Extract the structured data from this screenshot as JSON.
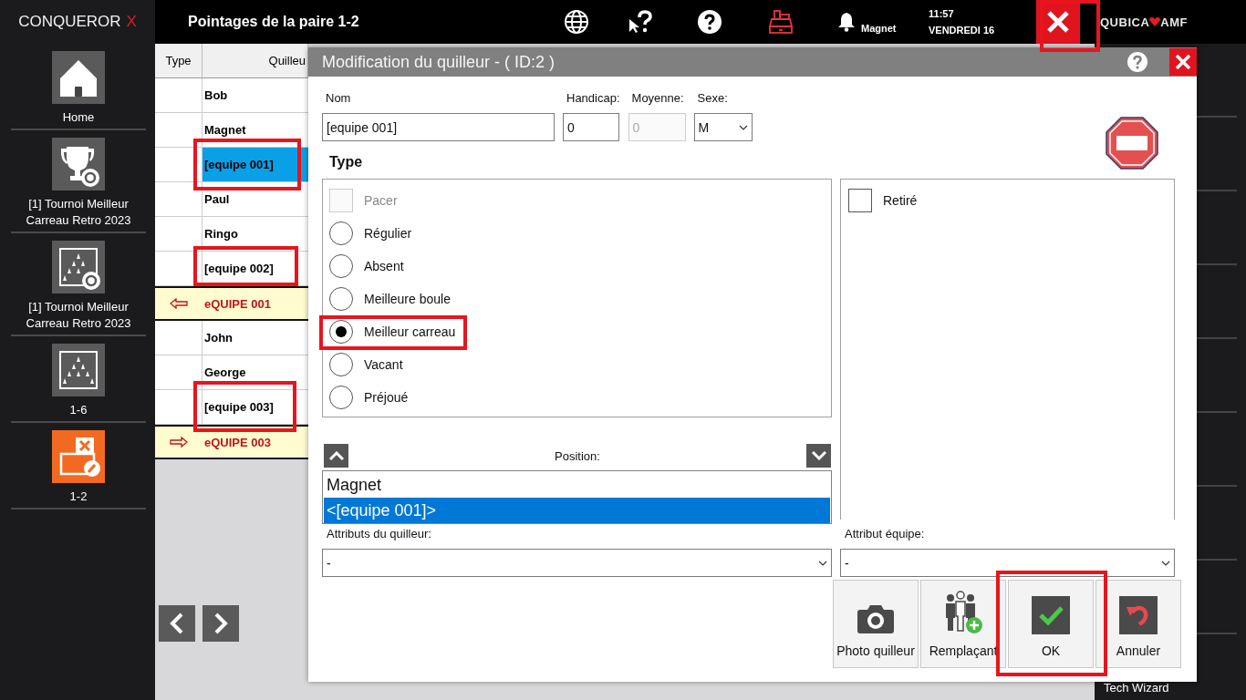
{
  "app": {
    "logo": "CONQUEROR",
    "logo_mark": "X"
  },
  "sidebar": {
    "items": [
      {
        "kind": "home",
        "label": "Home",
        "selected": false
      },
      {
        "kind": "trophy",
        "label": "[1] Tournoi Meilleur Carreau Retro 2023",
        "selected": false
      },
      {
        "kind": "lane-settings",
        "label": "[1] Tournoi Meilleur Carreau Retro 2023",
        "selected": false
      },
      {
        "kind": "lane",
        "label": "1-6",
        "selected": false
      },
      {
        "kind": "score",
        "label": "1-2",
        "selected": true
      }
    ]
  },
  "topbar": {
    "title": "Pointages de la paire 1-2",
    "user": "Magnet",
    "time": "11:57",
    "date": "VENDREDI 16",
    "brand": {
      "left": "QUBICA",
      "right": "AMF"
    }
  },
  "table": {
    "columns": [
      "Type",
      "Quilleu"
    ],
    "rows": [
      {
        "kind": "bowler",
        "name": "Bob",
        "selected": false
      },
      {
        "kind": "bowler",
        "name": "Magnet",
        "selected": false
      },
      {
        "kind": "bowler",
        "name": "[equipe 001]",
        "selected": true
      },
      {
        "kind": "bowler",
        "name": "Paul",
        "selected": false
      },
      {
        "kind": "bowler",
        "name": "Ringo",
        "selected": false
      },
      {
        "kind": "bowler",
        "name": "[equipe 002]",
        "selected": false
      },
      {
        "kind": "team-left",
        "name": "eQUIPE 001",
        "selected": false
      },
      {
        "kind": "bowler",
        "name": "John",
        "selected": false
      },
      {
        "kind": "bowler",
        "name": "George",
        "selected": false
      },
      {
        "kind": "bowler",
        "name": "[equipe 003]",
        "selected": false
      },
      {
        "kind": "team-right",
        "name": "eQUIPE 003",
        "selected": false
      }
    ]
  },
  "side_panel": {
    "label": "Tech Wizard"
  },
  "dialog": {
    "title": "Modification du quilleur - ( ID:2 )",
    "fields": [
      {
        "kind": "text",
        "label": "Nom",
        "value": "[equipe 001]",
        "disabled": false
      },
      {
        "kind": "text",
        "label": "Handicap:",
        "value": "0",
        "disabled": false
      },
      {
        "kind": "text",
        "label": "Moyenne:",
        "value": "0",
        "disabled": true
      },
      {
        "kind": "select",
        "label": "Sexe:",
        "value": "M",
        "disabled": false
      }
    ],
    "type_label": "Type",
    "type_options": [
      {
        "kind": "checkbox",
        "label": "Pacer",
        "checked": false,
        "disabled": true
      },
      {
        "kind": "radio",
        "label": "Régulier",
        "selected": false,
        "disabled": false
      },
      {
        "kind": "radio",
        "label": "Absent",
        "selected": false,
        "disabled": false
      },
      {
        "kind": "radio",
        "label": "Meilleure boule",
        "selected": false,
        "disabled": false
      },
      {
        "kind": "radio",
        "label": "Meilleur carreau",
        "selected": true,
        "disabled": false
      },
      {
        "kind": "radio",
        "label": "Vacant",
        "selected": false,
        "disabled": false
      },
      {
        "kind": "radio",
        "label": "Préjoué",
        "selected": false,
        "disabled": false
      }
    ],
    "retired": {
      "label": "Retiré",
      "checked": false
    },
    "position": {
      "label": "Position:",
      "items": [
        {
          "label": "Magnet",
          "selected": false
        },
        {
          "label": "<[equipe 001]>",
          "selected": true
        }
      ]
    },
    "bowler_attribute": {
      "label": "Attributs du quilleur:",
      "value": "-"
    },
    "team_attribute": {
      "label": "Attribut équipe:",
      "value": "-"
    },
    "buttons": [
      {
        "kind": "camera",
        "label": "Photo quilleur"
      },
      {
        "kind": "substitute",
        "label": "Remplaçant"
      },
      {
        "kind": "ok",
        "label": "OK"
      },
      {
        "kind": "cancel",
        "label": "Annuler"
      }
    ]
  }
}
